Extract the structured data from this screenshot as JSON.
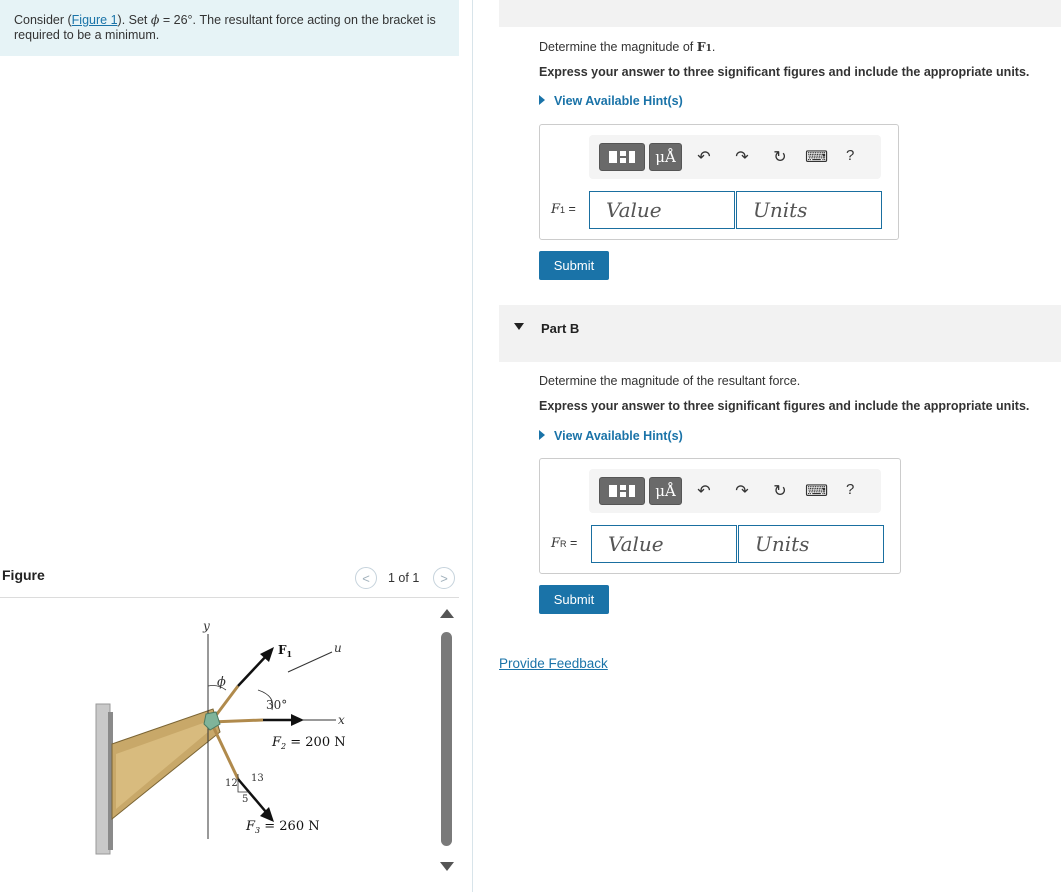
{
  "intro": {
    "text_before_link": "Consider (",
    "link": "Figure 1",
    "text_mid": "). Set ",
    "phi": "ϕ",
    "text_after": " = 26°. The resultant force acting on the bracket is required to be a minimum."
  },
  "figure": {
    "title": "Figure",
    "counter": "1 of 1",
    "prev_icon": "<",
    "next_icon": ">",
    "labels": {
      "y": "y",
      "u": "u",
      "x": "x",
      "phi": "ϕ",
      "f1": "F",
      "f1_sub": "1",
      "angle": "30°",
      "f2": "F",
      "f2_sub": "2",
      "f2_value": " = 200 N",
      "f3": "F",
      "f3_sub": "3",
      "f3_value": " = 260 N",
      "slope_12": "12",
      "slope_13": "13",
      "slope_5": "5"
    }
  },
  "partA": {
    "question_prefix": "Determine the magnitude of ",
    "question_var": "F",
    "question_sub": "1",
    "question_suffix": ".",
    "instruction": "Express your answer to three significant figures and include the appropriate units.",
    "hint": "View Available Hint(s)",
    "var_label": "F",
    "var_sub": "1",
    "eq": " =",
    "value_placeholder": "Value",
    "units_placeholder": "Units",
    "submit": "Submit"
  },
  "partB": {
    "title": "Part B",
    "question": "Determine the magnitude of the resultant force.",
    "instruction": "Express your answer to three significant figures and include the appropriate units.",
    "hint": "View Available Hint(s)",
    "var_label": "F",
    "var_sub": "R",
    "eq": " =",
    "value_placeholder": "Value",
    "units_placeholder": "Units",
    "submit": "Submit"
  },
  "toolbar": {
    "units_btn": "μÅ",
    "undo_icon": "↶",
    "redo_icon": "↷",
    "reset_icon": "↻",
    "keyboard_icon": "⌨",
    "help": "?"
  },
  "feedback": "Provide Feedback"
}
